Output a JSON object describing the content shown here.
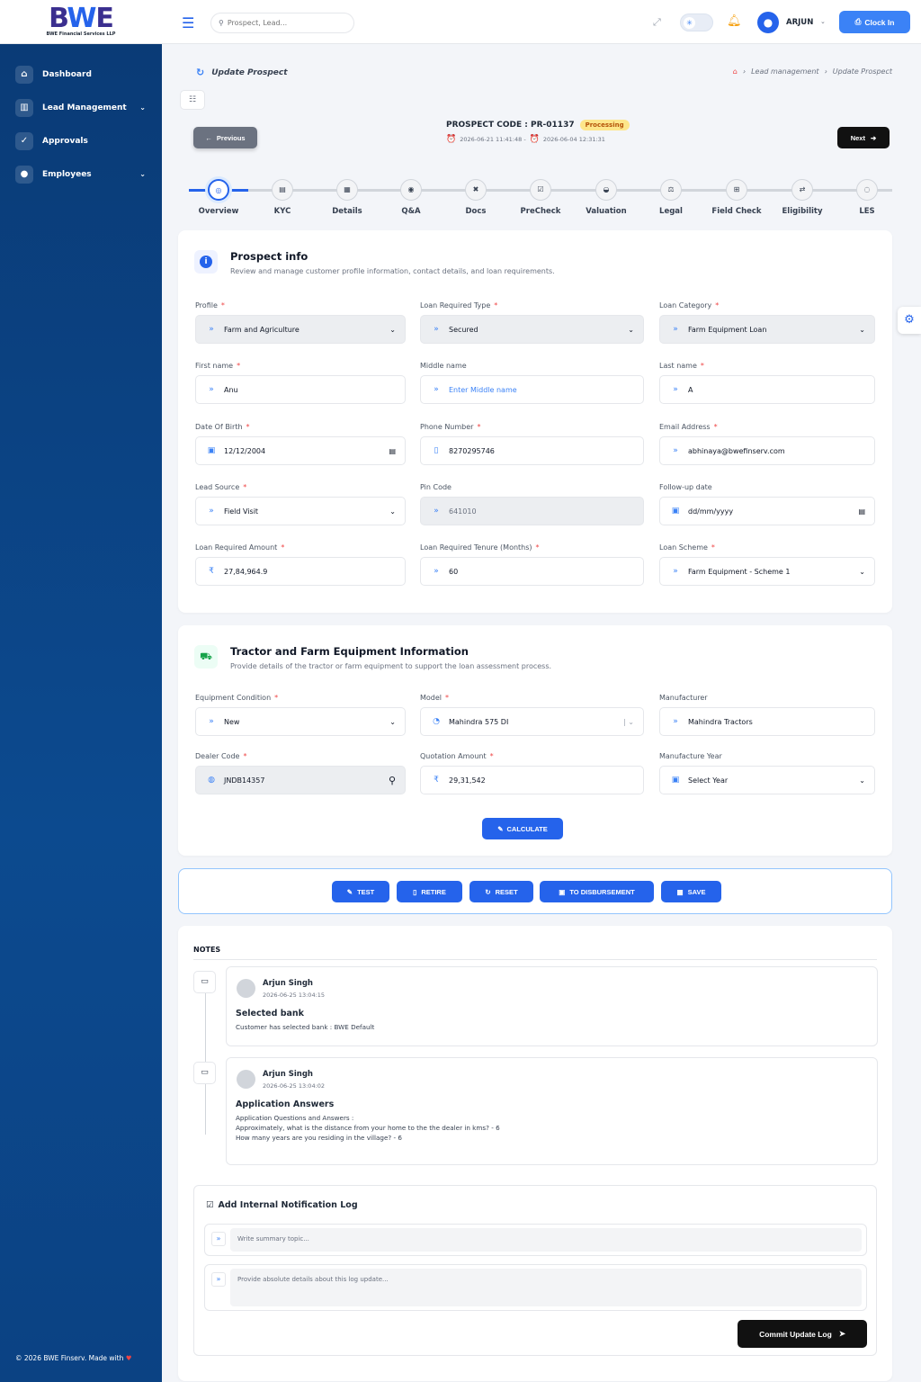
{
  "brand": {
    "logo": "BWE",
    "sub": "BWE Financial Services LLP"
  },
  "sidebar": {
    "items": [
      {
        "label": "Dashboard",
        "icon": "dashboard-icon",
        "chevron": false
      },
      {
        "label": "Lead Management",
        "icon": "chart-icon",
        "chevron": true
      },
      {
        "label": "Approvals",
        "icon": "check-circle-icon",
        "chevron": false
      },
      {
        "label": "Employees",
        "icon": "user-icon",
        "chevron": true
      }
    ],
    "footer": "© 2026 BWE Finserv. Made with"
  },
  "topbar": {
    "search_placeholder": "Prospect, Lead...",
    "user": "ARJUN",
    "clock_in": "Clock In"
  },
  "breadcrumb": {
    "title": "Update Prospect",
    "path": [
      "Lead management",
      "Update Prospect"
    ]
  },
  "prospect": {
    "code_label": "PROSPECT CODE : PR-01137",
    "status": "Processing",
    "created": "2026-06-21 11:41:48 -",
    "updated": "2026-06-04 12:31:31",
    "prev": "Previous",
    "next": "Next"
  },
  "steps": [
    "Overview",
    "KYC",
    "Details",
    "Q&A",
    "Docs",
    "PreCheck",
    "Valuation",
    "Legal",
    "Field Check",
    "Eligibility",
    "LES"
  ],
  "prospect_info": {
    "title": "Prospect info",
    "subtitle": "Review and manage customer profile information, contact details, and loan requirements.",
    "fields": {
      "profile": {
        "label": "Profile",
        "value": "Farm and Agriculture"
      },
      "loan_type": {
        "label": "Loan Required Type",
        "value": "Secured"
      },
      "loan_category": {
        "label": "Loan Category",
        "value": "Farm Equipment Loan"
      },
      "first_name": {
        "label": "First name",
        "value": "Anu"
      },
      "middle_name": {
        "label": "Middle name",
        "placeholder": "Enter Middle name"
      },
      "last_name": {
        "label": "Last name",
        "value": "A"
      },
      "dob": {
        "label": "Date Of Birth",
        "value": "12/12/2004"
      },
      "phone": {
        "label": "Phone Number",
        "value": "8270295746"
      },
      "email": {
        "label": "Email Address",
        "value": "abhinaya@bwefinserv.com"
      },
      "lead_source": {
        "label": "Lead Source",
        "value": "Field Visit"
      },
      "pin": {
        "label": "Pin Code",
        "value": "641010"
      },
      "followup": {
        "label": "Follow-up date",
        "value": "dd/mm/yyyy"
      },
      "amount": {
        "label": "Loan Required Amount",
        "value": "27,84,964.9"
      },
      "tenure": {
        "label": "Loan Required Tenure (Months)",
        "value": "60"
      },
      "scheme": {
        "label": "Loan Scheme",
        "value": "Farm Equipment - Scheme 1"
      }
    }
  },
  "equipment": {
    "title": "Tractor and Farm Equipment Information",
    "subtitle": "Provide details of the tractor or farm equipment to support the loan assessment process.",
    "fields": {
      "condition": {
        "label": "Equipment Condition",
        "value": "New"
      },
      "model": {
        "label": "Model",
        "value": "Mahindra 575 DI"
      },
      "manufacturer": {
        "label": "Manufacturer",
        "value": "Mahindra Tractors"
      },
      "dealer": {
        "label": "Dealer Code",
        "value": "JNDB14357"
      },
      "quotation": {
        "label": "Quotation Amount",
        "value": "29,31,542"
      },
      "year": {
        "label": "Manufacture Year",
        "value": "Select Year"
      }
    },
    "calculate": "CALCULATE"
  },
  "actions": [
    "TEST",
    "RETIRE",
    "RESET",
    "TO DISBURSEMENT",
    "SAVE"
  ],
  "notes": {
    "title": "NOTES",
    "items": [
      {
        "name": "Arjun Singh",
        "date": "2026-06-25 13:04:15",
        "title": "Selected bank",
        "body": [
          "Customer has selected bank : BWE Default"
        ]
      },
      {
        "name": "Arjun Singh",
        "date": "2026-06-25 13:04:02",
        "title": "Application Answers",
        "body": [
          "Application Questions and Answers :",
          "Approximately, what is the distance from your home to the the dealer in kms? - 6",
          "How many years are you residing in the village? - 6"
        ]
      }
    ]
  },
  "log": {
    "title": "Add Internal Notification Log",
    "summary_placeholder": "Write summary topic...",
    "details_placeholder": "Provide absolute details about this log update...",
    "commit": "Commit Update Log"
  }
}
